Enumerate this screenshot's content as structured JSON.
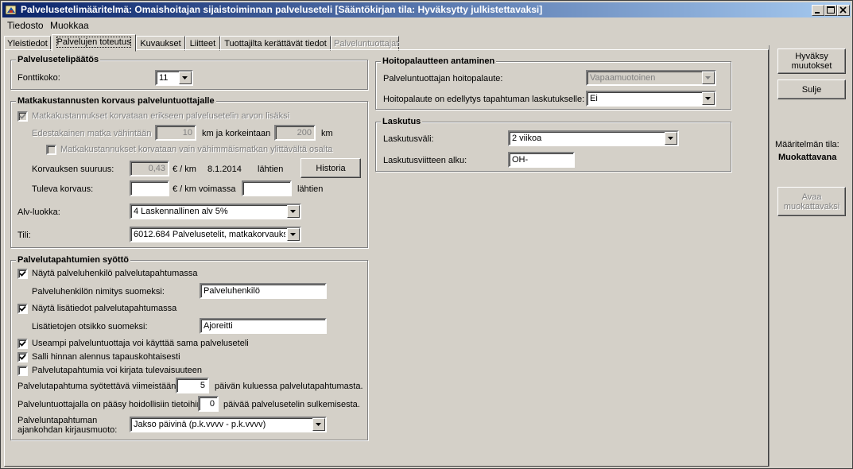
{
  "window": {
    "title": "Palvelusetelimääritelmä: Omaishoitajan sijaistoiminnan palveluseteli  [Sääntökirjan tila: Hyväksytty julkistettavaksi]"
  },
  "menu": {
    "file": "Tiedosto",
    "edit": "Muokkaa"
  },
  "tabs": [
    "Yleistiedot",
    "Palvelujen toteutus",
    "Kuvaukset",
    "Liitteet",
    "Tuottajilta kerättävät tiedot",
    "Palveluntuottajat"
  ],
  "decision": {
    "title": "Palvelusetelipäätös",
    "font_label": "Fonttikoko:",
    "font_value": "11"
  },
  "travel": {
    "title": "Matkakustannusten korvaus palveluntuottajalle",
    "separate_label": "Matkakustannukset korvataan erikseen palvelusetelin arvon lisäksi",
    "trip_label": "Edestakainen matka vähintään",
    "trip_min": "10",
    "km_and_max": "km ja korkeintaan",
    "trip_max": "200",
    "km": "km",
    "only_over_label": "Matkakustannukset korvataan vain vähimmäismatkan ylittävältä osalta",
    "amount_label": "Korvauksen suuruus:",
    "amount_value": "0,43",
    "eur_km": "€ / km",
    "date": "8.1.2014",
    "from": "lähtien",
    "history_button": "Historia",
    "future_label": "Tuleva korvaus:",
    "future_value": "",
    "eur_km_valid": "€ / km  voimassa",
    "future_date": "",
    "from2": "lähtien",
    "vat_label": "Alv-luokka:",
    "vat_value": "4 Laskennallinen alv 5%",
    "account_label": "Tili:",
    "account_value": "6012.684 Palvelusetelit, matkakorvaukse"
  },
  "events": {
    "title": "Palvelutapahtumien syöttö",
    "show_person_label": "Näytä palveluhenkilö palvelutapahtumassa",
    "person_name_label": "Palveluhenkilön nimitys suomeksi:",
    "person_name_value": "Palveluhenkilö",
    "show_extra_label": "Näytä lisätiedot palvelutapahtumassa",
    "extra_title_label": "Lisätietojen otsikko suomeksi:",
    "extra_title_value": "Ajoreitti",
    "multi_provider_label": "Useampi palveluntuottaja voi käyttää sama palveluseteli",
    "allow_discount_label": "Salli hinnan alennus tapauskohtaisesti",
    "future_events_label": "Palvelutapahtumia voi kirjata tulevaisuuteen",
    "deadline_prefix": "Palvelutapahtuma syötettävä viimeistään",
    "deadline_value": "5",
    "deadline_suffix": "päivän kuluessa palvelutapahtumasta.",
    "access_prefix": "Palveluntuottajalla on pääsy hoidollisiin tietoihin",
    "access_value": "0",
    "access_suffix": "päivää palvelusetelin sulkemisesta.",
    "time_format_label_1": "Palveluntapahtuman",
    "time_format_label_2": "ajankohdan kirjausmuoto:",
    "time_format_value": "Jakso päivinä (p.k.vvvv - p.k.vvvv)"
  },
  "feedback": {
    "title": "Hoitopalautteen antaminen",
    "provider_feedback_label": "Palveluntuottajan hoitopalaute:",
    "provider_feedback_value": "Vapaamuotoinen",
    "required_label": "Hoitopalaute on edellytys tapahtuman laskutukselle:",
    "required_value": "Ei"
  },
  "billing": {
    "title": "Laskutus",
    "interval_label": "Laskutusväli:",
    "interval_value": "2 viikoa",
    "ref_label": "Laskutusviitteen alku:",
    "ref_value": "OH-"
  },
  "sidebar": {
    "approve_line1": "Hyväksy",
    "approve_line2": "muutokset",
    "close": "Sulje",
    "status_label": "Määritelmän tila:",
    "status_value": "Muokattavana",
    "open_line1": "Avaa",
    "open_line2": "muokattavaksi"
  }
}
